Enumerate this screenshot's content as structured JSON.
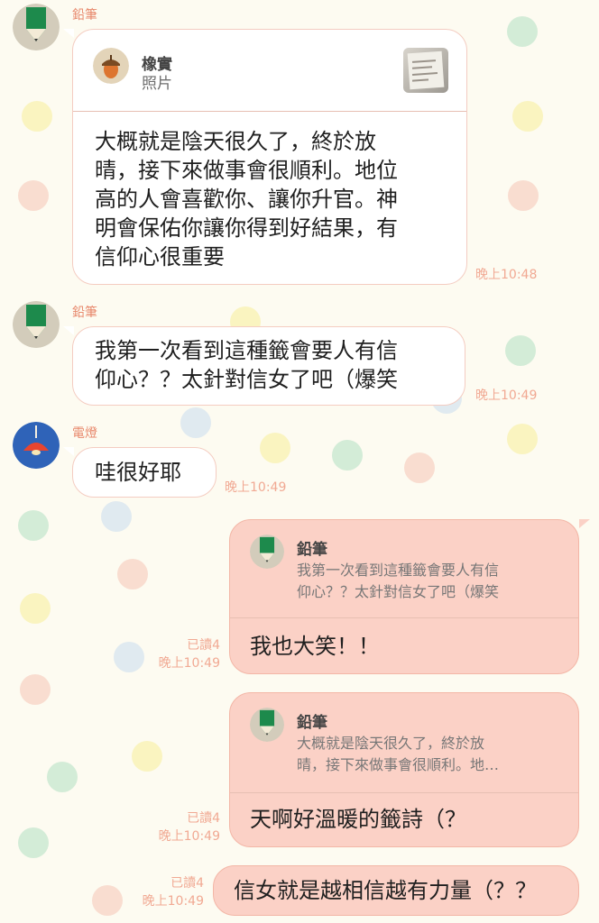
{
  "contacts": {
    "pencil": "鉛筆",
    "lamp": "電燈",
    "acorn": "橡實"
  },
  "icons": {
    "pencil_avatar": "pencil-avatar",
    "lamp_avatar": "lamp-avatar",
    "acorn_avatar": "acorn-avatar",
    "photo_thumbnail": "photo-thumbnail"
  },
  "colors": {
    "background": "#fdfbf1",
    "sent_bubble": "#fbd1c6",
    "received_bubble": "#ffffff",
    "accent_text": "#e8896d",
    "pencil_green": "#1d8a4c",
    "lamp_blue": "#2f63b8",
    "lamp_red": "#e8452f"
  },
  "messages": [
    {
      "sender": "鉛筆",
      "reply_to": {
        "name": "橡實",
        "type": "照片"
      },
      "lines": [
        "大概就是陰天很久了，終於放",
        "晴，接下來做事會很順利。地位",
        "高的人會喜歡你、讓你升官。神",
        "明會保佑你讓你得到好結果，有",
        "信仰心很重要"
      ],
      "time": "晚上10:48"
    },
    {
      "sender": "鉛筆",
      "lines": [
        "我第一次看到這種籤會要人有信",
        "仰心？？太針對信女了吧（爆笑"
      ],
      "time": "晚上10:49"
    },
    {
      "sender": "電燈",
      "lines": [
        "哇很好耶"
      ],
      "time": "晚上10:49"
    },
    {
      "direction": "outgoing",
      "reply_to": {
        "name": "鉛筆",
        "lines": [
          "我第一次看到這種籤會要人有信",
          "仰心？？太針對信女了吧（爆笑"
        ]
      },
      "text": "我也大笑！！",
      "read": "已讀4",
      "time": "晚上10:49"
    },
    {
      "direction": "outgoing",
      "reply_to": {
        "name": "鉛筆",
        "lines": [
          "大概就是陰天很久了，終於放",
          "晴，接下來做事會很順利。地…"
        ]
      },
      "text": "天啊好溫暖的籤詩（？",
      "read": "已讀4",
      "time": "晚上10:49"
    },
    {
      "direction": "outgoing",
      "text": "信女就是越相信越有力量（？？",
      "read": "已讀4",
      "time": "晚上10:49"
    }
  ]
}
